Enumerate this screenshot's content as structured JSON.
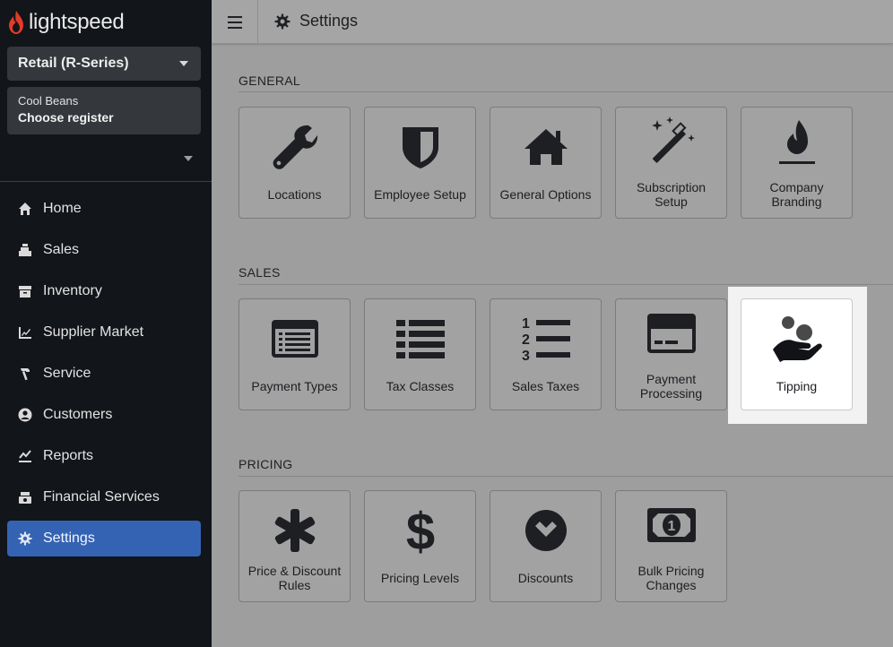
{
  "brand": {
    "name": "lightspeed",
    "accent": "#e33b2a"
  },
  "sidebar": {
    "shop_selector": "Retail (R-Series)",
    "register": {
      "shop": "Cool Beans",
      "action": "Choose register"
    },
    "items": [
      {
        "label": "Home",
        "icon": "home-icon"
      },
      {
        "label": "Sales",
        "icon": "register-icon"
      },
      {
        "label": "Inventory",
        "icon": "inventory-icon"
      },
      {
        "label": "Supplier Market",
        "icon": "supplier-market-icon"
      },
      {
        "label": "Service",
        "icon": "hammer-icon"
      },
      {
        "label": "Customers",
        "icon": "user-circle-icon"
      },
      {
        "label": "Reports",
        "icon": "chart-line-icon"
      },
      {
        "label": "Financial Services",
        "icon": "cash-register-icon"
      },
      {
        "label": "Settings",
        "icon": "gear-icon",
        "active": true
      }
    ],
    "active_color": "#3563b4"
  },
  "topbar": {
    "title": "Settings",
    "menu_icon": "hamburger-icon",
    "title_icon": "gear-icon"
  },
  "sections": {
    "general": {
      "label": "GENERAL",
      "tiles": [
        {
          "label": "Locations",
          "icon": "wrench-icon"
        },
        {
          "label": "Employee Setup",
          "icon": "shield-icon"
        },
        {
          "label": "General Options",
          "icon": "home-icon"
        },
        {
          "label": "Subscription Setup",
          "icon": "magic-wand-icon"
        },
        {
          "label": "Company Branding",
          "icon": "flame-icon"
        }
      ]
    },
    "sales": {
      "label": "SALES",
      "tiles": [
        {
          "label": "Payment Types",
          "icon": "list-card-icon"
        },
        {
          "label": "Tax Classes",
          "icon": "list-icon"
        },
        {
          "label": "Sales Taxes",
          "icon": "numbered-list-icon"
        },
        {
          "label": "Payment Processing",
          "icon": "credit-card-icon"
        },
        {
          "label": "Tipping",
          "icon": "hand-coins-icon",
          "highlighted": true
        }
      ]
    },
    "pricing": {
      "label": "PRICING",
      "tiles": [
        {
          "label": "Price & Discount Rules",
          "icon": "asterisk-icon"
        },
        {
          "label": "Pricing Levels",
          "icon": "dollar-icon"
        },
        {
          "label": "Discounts",
          "icon": "chevron-circle-icon"
        },
        {
          "label": "Bulk Pricing Changes",
          "icon": "banknote-icon"
        }
      ]
    }
  }
}
